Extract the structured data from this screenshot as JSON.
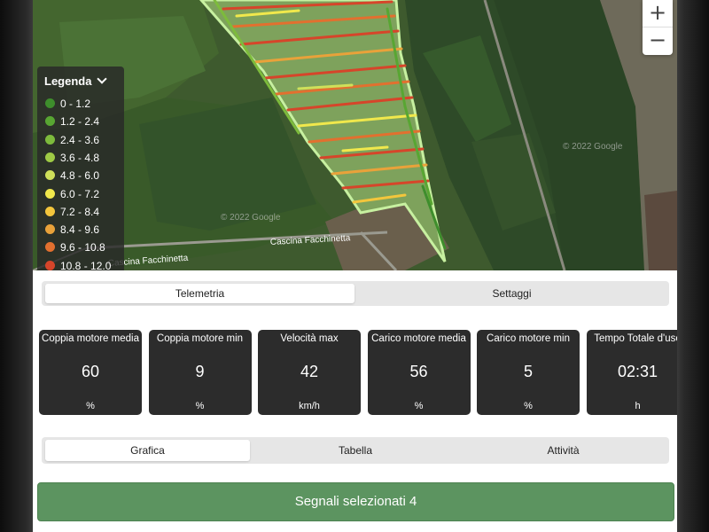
{
  "map": {
    "legend_title": "Legenda",
    "legend_toggle_icon": "chevron-down-icon",
    "legend_items": [
      {
        "range": "0 - 1.2",
        "color": "#3e8e2c"
      },
      {
        "range": "1.2 - 2.4",
        "color": "#58a632"
      },
      {
        "range": "2.4 - 3.6",
        "color": "#7dbb3c"
      },
      {
        "range": "3.6 - 4.8",
        "color": "#9fcb45"
      },
      {
        "range": "4.8 - 6.0",
        "color": "#cfe05a"
      },
      {
        "range": "6.0 - 7.2",
        "color": "#f0e84c"
      },
      {
        "range": "7.2 - 8.4",
        "color": "#f3c63c"
      },
      {
        "range": "8.4 - 9.6",
        "color": "#e9a23a"
      },
      {
        "range": "9.6 - 10.8",
        "color": "#e2702f"
      },
      {
        "range": "10.8 - 12.0",
        "color": "#d6452a"
      }
    ],
    "road_label_1": "Cascina Facchinetta",
    "road_label_2": "Cascina Facchinetta",
    "zoom_in": "+",
    "zoom_out": "−"
  },
  "tabs_top": [
    {
      "label": "Telemetria",
      "active": true
    },
    {
      "label": "Settaggi",
      "active": false
    }
  ],
  "cards": [
    {
      "label": "Coppia motore media",
      "value": "60",
      "unit": "%"
    },
    {
      "label": "Coppia motore min",
      "value": "9",
      "unit": "%"
    },
    {
      "label": "Velocità max",
      "value": "42",
      "unit": "km/h"
    },
    {
      "label": "Carico motore media",
      "value": "56",
      "unit": "%"
    },
    {
      "label": "Carico motore min",
      "value": "5",
      "unit": "%"
    },
    {
      "label": "Tempo Totale d'uso",
      "value": "02:31",
      "unit": "h"
    }
  ],
  "tabs_bottom": [
    {
      "label": "Grafica",
      "active": true
    },
    {
      "label": "Tabella",
      "active": false
    },
    {
      "label": "Attività",
      "active": false
    }
  ],
  "signals_button": "Segnali selezionati 4",
  "colors": {
    "accent_green": "#5c9460",
    "card_bg": "#2c2c2c"
  }
}
